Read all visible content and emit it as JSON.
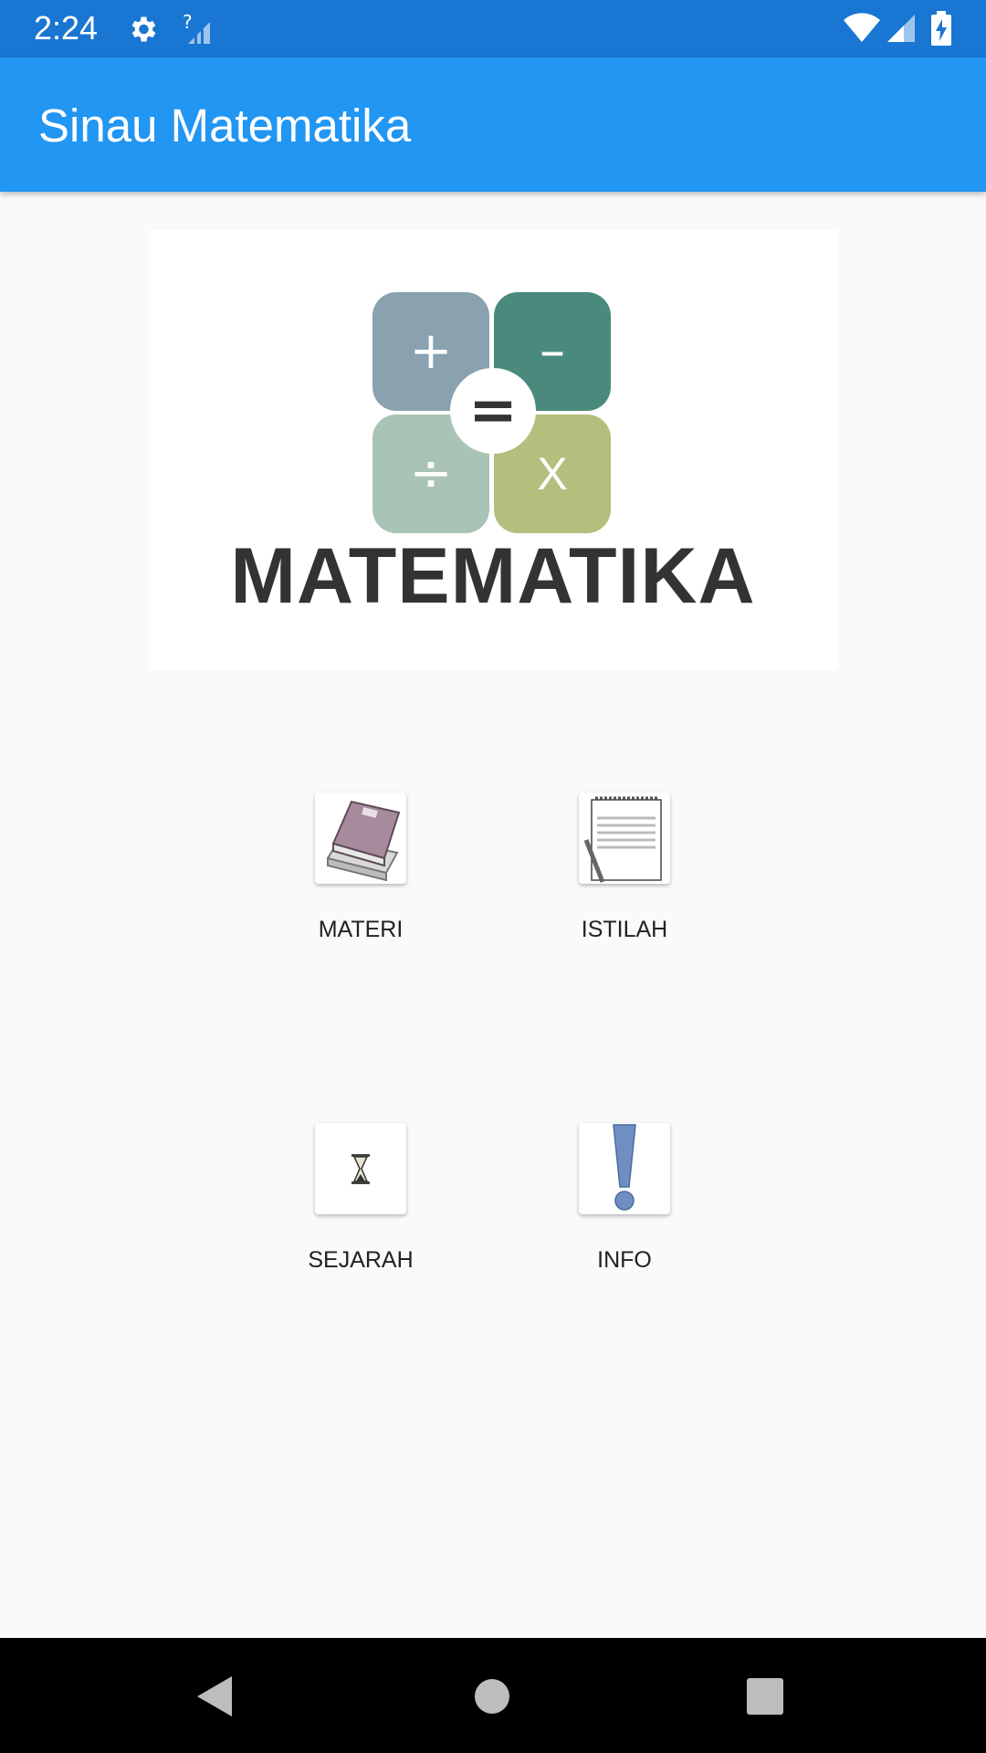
{
  "status_bar": {
    "time": "2:24",
    "icons": [
      "settings-icon",
      "no-sim-signal-icon",
      "wifi-icon",
      "cell-signal-icon",
      "battery-charging-icon"
    ]
  },
  "app_bar": {
    "title": "Sinau Matematika"
  },
  "logo": {
    "symbols": {
      "plus": "+",
      "minus": "–",
      "divide": "÷",
      "times": "X",
      "equals": "="
    },
    "word": "MATEMATIKA",
    "colors": {
      "plus": "#8aa1b0",
      "minus": "#4a8a7c",
      "divide": "#a9c4b4",
      "times": "#b2bf7d",
      "text": "#333333"
    }
  },
  "menu": {
    "items": [
      {
        "label": "MATERI",
        "icon": "books-icon"
      },
      {
        "label": "ISTILAH",
        "icon": "notepad-icon"
      },
      {
        "label": "SEJARAH",
        "icon": "hourglass-icon"
      },
      {
        "label": "INFO",
        "icon": "exclamation-icon"
      }
    ]
  },
  "nav_bar": {
    "buttons": [
      "back-icon",
      "home-icon",
      "recents-icon"
    ]
  },
  "colors": {
    "status_bar": "#1976d2",
    "app_bar": "#2196f3",
    "background": "#fafafa",
    "nav_bar": "#000000"
  }
}
